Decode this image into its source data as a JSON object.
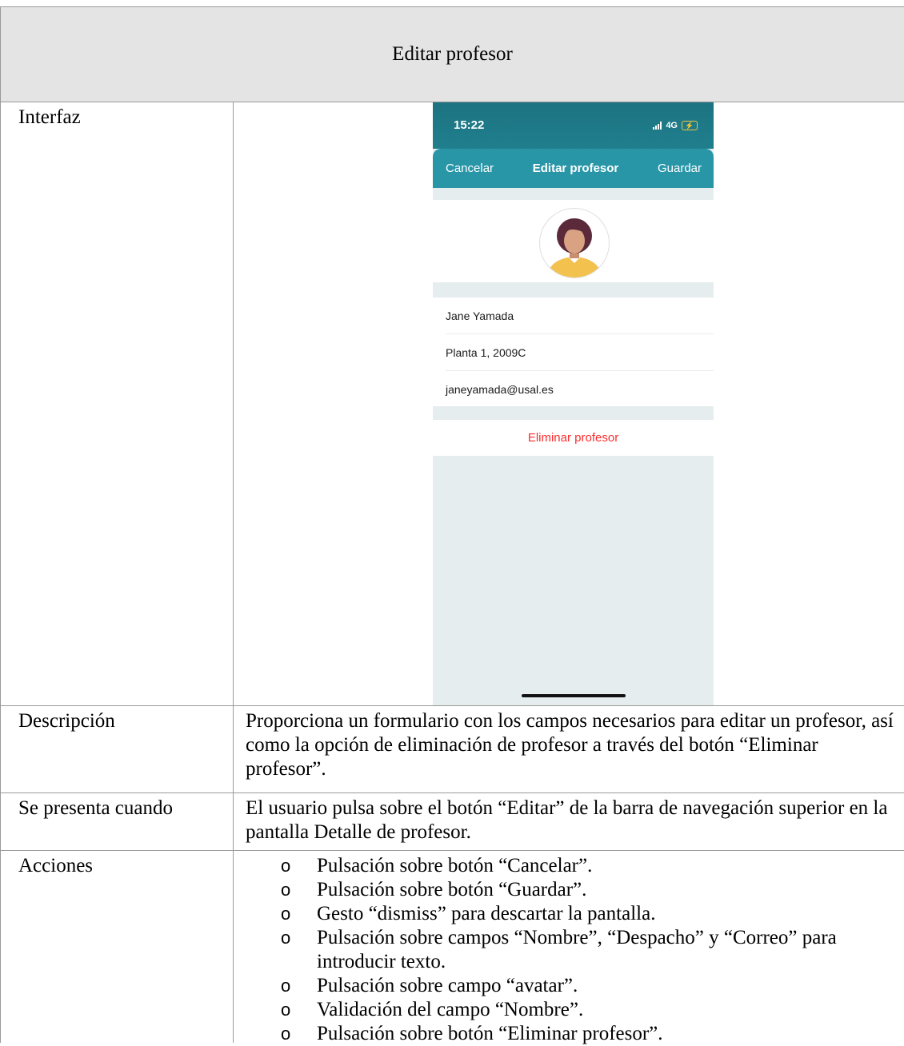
{
  "table": {
    "title": "Editar profesor",
    "rows": {
      "interfaz": {
        "label": "Interfaz"
      },
      "descripcion": {
        "label": "Descripción",
        "text": "Proporciona un formulario con los campos necesarios para editar un profesor, así como la opción de eliminación de profesor a través del botón “Eliminar profesor”."
      },
      "se_presenta": {
        "label": "Se presenta cuando",
        "text": "El usuario pulsa sobre el botón “Editar” de la barra de navegación superior en la pantalla Detalle de profesor."
      },
      "acciones": {
        "label": "Acciones",
        "bullet": "o",
        "items": [
          "Pulsación sobre botón “Cancelar”.",
          "Pulsación sobre botón “Guardar”.",
          "Gesto “dismiss” para descartar la pantalla.",
          "Pulsación sobre campos “Nombre”, “Despacho” y “Correo” para introducir texto.",
          "Pulsación sobre campo “avatar”.",
          "Validación del campo “Nombre”.",
          "Pulsación sobre botón “Eliminar profesor”."
        ]
      }
    }
  },
  "phone": {
    "status": {
      "time": "15:22",
      "network": "4G",
      "battery_icon": "battery-charging-icon"
    },
    "nav": {
      "cancel": "Cancelar",
      "title": "Editar profesor",
      "save": "Guardar"
    },
    "fields": {
      "name": "Jane Yamada",
      "office": "Planta 1, 2009C",
      "email": "janeyamada@usal.es"
    },
    "delete_button": "Eliminar profesor",
    "colors": {
      "status_bar": "#1c7381",
      "nav_bar": "#2996a8",
      "background": "#e6edee",
      "delete": "#ff2d2d",
      "avatar_hair": "#5a2a3a",
      "avatar_skin": "#d8a283",
      "avatar_shirt": "#f2c14e"
    }
  }
}
